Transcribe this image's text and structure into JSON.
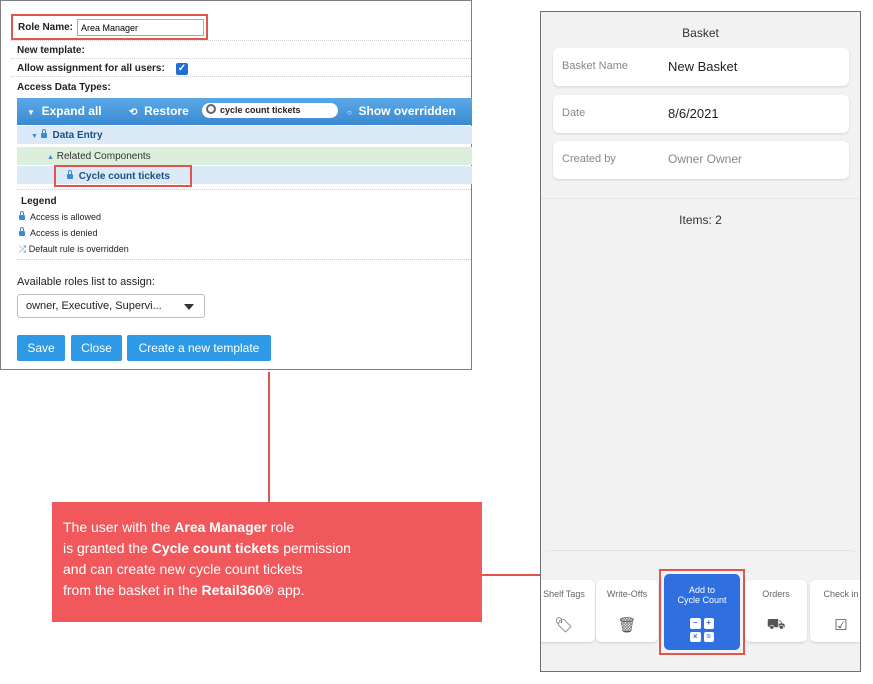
{
  "admin": {
    "role_name_label": "Role Name:",
    "role_name_value": "Area Manager",
    "new_template_label": "New template:",
    "allow_assignment_label": "Allow assignment for all users:",
    "access_data_types_label": "Access Data Types:",
    "toolbar": {
      "expand_all": "Expand all",
      "restore": "Restore",
      "search_value": "cycle count tickets",
      "show_overridden": "Show overridden"
    },
    "tree": {
      "data_entry": "Data Entry",
      "related_components": "Related Components",
      "cycle_count_tickets": "Cycle count tickets"
    },
    "legend": {
      "title": "Legend",
      "allowed": "Access is allowed",
      "denied": "Access is denied",
      "overridden": "Default rule is overridden"
    },
    "available_roles_label": "Available roles list to assign:",
    "available_roles_value": "owner, Executive, Supervi...",
    "buttons": {
      "save": "Save",
      "close": "Close",
      "create_template": "Create a new template"
    }
  },
  "callout": {
    "line1_pre": "The user with the ",
    "line1_bold": "Area Manager",
    "line1_post": " role",
    "line2_pre": "is granted the ",
    "line2_bold": "Cycle count tickets",
    "line2_post": " permission",
    "line3": "and can create new cycle count tickets",
    "line4_pre": "from the basket in the ",
    "line4_bold": "Retail360®",
    "line4_post": " app."
  },
  "phone": {
    "title": "Basket",
    "fields": [
      {
        "label": "Basket Name",
        "value": "New Basket"
      },
      {
        "label": "Date",
        "value": "8/6/2021"
      },
      {
        "label": "Created by",
        "value": "Owner Owner"
      }
    ],
    "items_count": "Items: 2",
    "actions": {
      "shelf_tags": "Shelf Tags",
      "write_offs": "Write-Offs",
      "add_to_cycle_line1": "Add to",
      "add_to_cycle_line2": "Cycle Count",
      "orders": "Orders",
      "check_in": "Check in"
    }
  },
  "colors": {
    "highlight": "#e1554f",
    "callout_bg": "#f0585c",
    "toolbar_blue": "#3b8ad2",
    "button_blue": "#2e9ae6",
    "app_blue": "#2f6fe0"
  }
}
